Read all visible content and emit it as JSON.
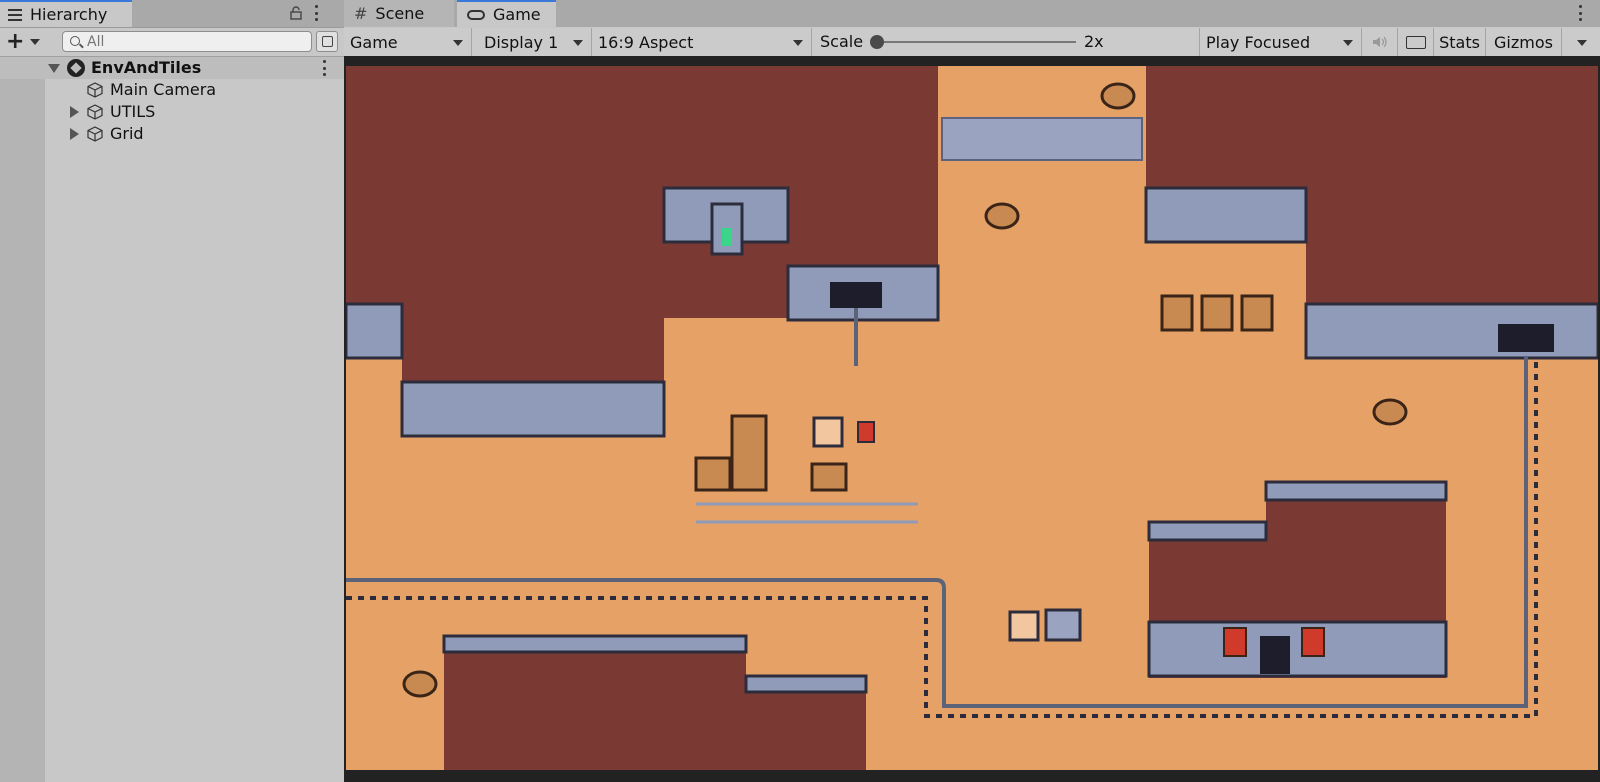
{
  "hierarchy": {
    "tab_label": "Hierarchy",
    "search_placeholder": "All",
    "items": [
      {
        "label": "EnvAndTiles",
        "icon": "unity-scene-icon",
        "expanded": true
      },
      {
        "label": "Main Camera",
        "icon": "gameobject-cube-icon"
      },
      {
        "label": "UTILS",
        "icon": "gameobject-cube-icon",
        "expanded": false
      },
      {
        "label": "Grid",
        "icon": "gameobject-cube-icon",
        "expanded": false
      }
    ]
  },
  "tabs": {
    "scene": "Scene",
    "game": "Game"
  },
  "toolbar": {
    "view_mode": "Game",
    "display": "Display 1",
    "aspect": "16:9 Aspect",
    "scale_label": "Scale",
    "scale_value": "2x",
    "play_mode": "Play Focused",
    "stats": "Stats",
    "gizmos": "Gizmos"
  },
  "colors": {
    "accent_tab": "#3a79d8",
    "sand": "#e6a266",
    "dirt": "#7a3a33",
    "stone": "#8f9bb8"
  },
  "game_view": {
    "description_icon": "pixel-art-dungeon-scene"
  }
}
